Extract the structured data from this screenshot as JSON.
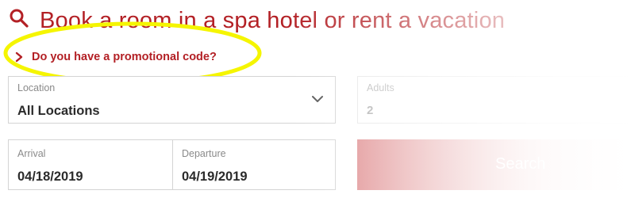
{
  "header": {
    "icon": "search-icon",
    "title": "Book a room in a spa hotel or rent a vacation"
  },
  "promo": {
    "icon": "chevron-right-icon",
    "label": "Do you have a promotional code?"
  },
  "form": {
    "location": {
      "label": "Location",
      "value": "All Locations",
      "icon": "chevron-down-icon"
    },
    "adults": {
      "label": "Adults",
      "value": "2"
    },
    "arrival": {
      "label": "Arrival",
      "value": "04/18/2019"
    },
    "departure": {
      "label": "Departure",
      "value": "04/19/2019"
    },
    "search_button": {
      "label": "Search"
    }
  },
  "colors": {
    "accent": "#b32025",
    "highlight": "#f5f500",
    "border": "#d4d4d4"
  }
}
